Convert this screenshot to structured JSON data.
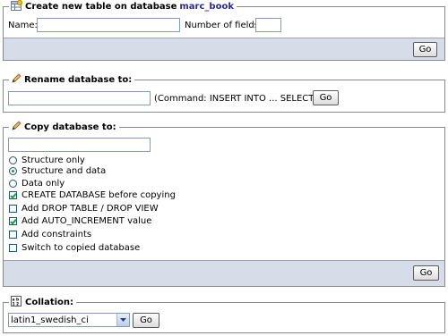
{
  "create_table": {
    "legend": "Create new table on database",
    "database": "marc_book",
    "name_label": "Name:",
    "name_value": "",
    "fields_label": "Number of fields:",
    "fields_value": "",
    "go_label": "Go"
  },
  "rename_db": {
    "legend": "Rename database to:",
    "value": "",
    "command_note": "(Command: INSERT INTO ... SELECT)",
    "go_label": "Go"
  },
  "copy_db": {
    "legend": "Copy database to:",
    "value": "",
    "radios": [
      {
        "label": "Structure only",
        "checked": false
      },
      {
        "label": "Structure and data",
        "checked": true
      },
      {
        "label": "Data only",
        "checked": false
      }
    ],
    "checkboxes": [
      {
        "label": "CREATE DATABASE before copying",
        "checked": true
      },
      {
        "label": "Add DROP TABLE / DROP VIEW",
        "checked": false
      },
      {
        "label": "Add AUTO_INCREMENT value",
        "checked": true
      },
      {
        "label": "Add constraints",
        "checked": false
      },
      {
        "label": "Switch to copied database",
        "checked": false
      }
    ],
    "go_label": "Go"
  },
  "collation": {
    "legend": "Collation:",
    "selected": "latin1_swedish_ci",
    "go_label": "Go"
  }
}
